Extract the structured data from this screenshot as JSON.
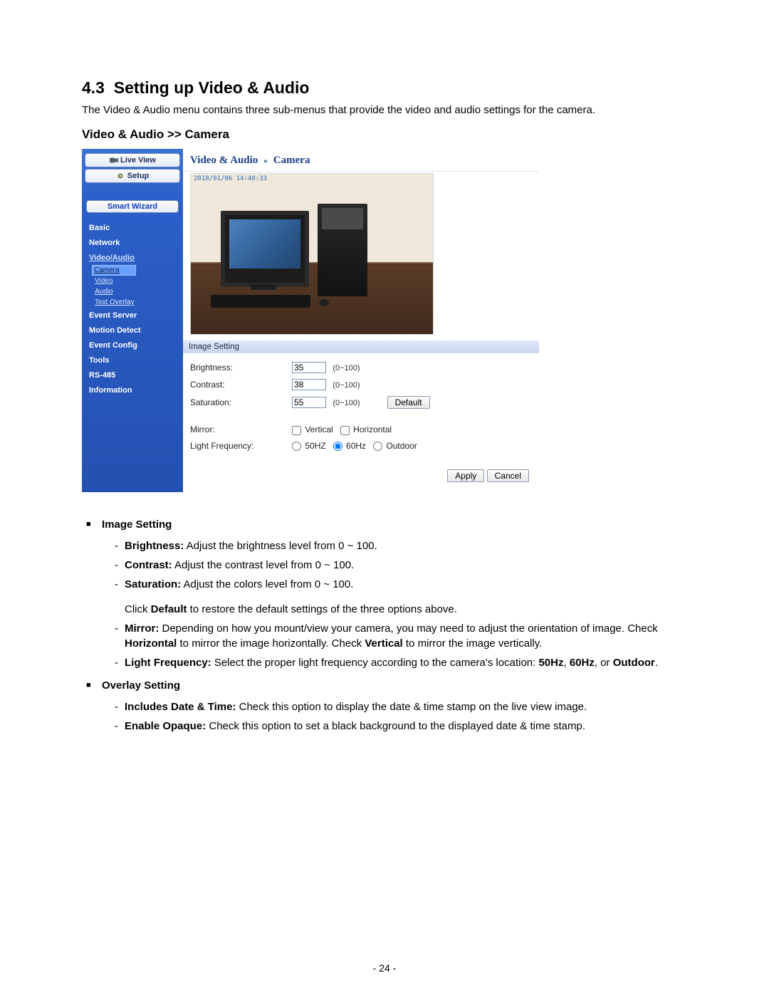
{
  "doc": {
    "section_number": "4.3",
    "section_title": "Setting up Video & Audio",
    "intro_text": "The Video & Audio menu contains three sub-menus that provide the video and audio settings for the camera.",
    "subhead": "Video & Audio >> Camera",
    "page_number": "- 24 -"
  },
  "ui": {
    "nav": {
      "live_view": "Live View",
      "setup": "Setup",
      "smart_wizard": "Smart Wizard",
      "links": {
        "basic": "Basic",
        "network": "Network",
        "video_audio": "Video/Audio",
        "camera": "Camera",
        "video": "Video",
        "audio": "Audio",
        "text_overlay": "Text Overlay",
        "event_server": "Event Server",
        "motion_detect": "Motion Detect",
        "event_config": "Event Config",
        "tools": "Tools",
        "rs485": "RS-485",
        "information": "Information"
      }
    },
    "breadcrumb": {
      "root": "Video & Audio",
      "separator": "»",
      "leaf": "Camera"
    },
    "preview": {
      "timestamp": "2018/01/06 14:40:33"
    },
    "panel_title": "Image Setting",
    "fields": {
      "brightness": {
        "label": "Brightness:",
        "value": "35",
        "range": "(0~100)"
      },
      "contrast": {
        "label": "Contrast:",
        "value": "38",
        "range": "(0~100)"
      },
      "saturation": {
        "label": "Saturation:",
        "value": "55",
        "range": "(0~100)"
      },
      "default_btn": "Default",
      "mirror": {
        "label": "Mirror:",
        "vertical": "Vertical",
        "horizontal": "Horizontal"
      },
      "light": {
        "label": "Light Frequency:",
        "opt50": "50HZ",
        "opt60": "60Hz",
        "optOut": "Outdoor"
      }
    },
    "actions": {
      "apply": "Apply",
      "cancel": "Cancel"
    }
  },
  "defs": {
    "image_setting": {
      "head": "Image Setting",
      "brightness": {
        "lead": "Brightness:",
        "body": " Adjust the brightness level from 0 ~ 100."
      },
      "contrast": {
        "lead": "Contrast:",
        "body": " Adjust the contrast level from 0 ~ 100."
      },
      "saturation": {
        "lead": "Saturation:",
        "body": " Adjust the colors level from 0 ~ 100."
      },
      "default_note_pre": "Click ",
      "default_note_bold": "Default",
      "default_note_post": " to restore the default settings of the three options above.",
      "mirror_lead": "Mirror:",
      "mirror_body1": " Depending on how you mount/view your camera, you may need to adjust the orientation of image. Check ",
      "mirror_b1": "Horizontal",
      "mirror_body2": " to mirror the image horizontally. Check ",
      "mirror_b2": "Vertical",
      "mirror_body3": " to mirror the image vertically.",
      "light_lead": "Light Frequency:",
      "light_body1": " Select the proper light frequency according to the camera's location: ",
      "light_b1": "50Hz",
      "light_sep1": ", ",
      "light_b2": "60Hz",
      "light_sep2": ", or ",
      "light_b3": "Outdoor",
      "light_end": "."
    },
    "overlay_setting": {
      "head": "Overlay Setting",
      "inc_dt_lead": "Includes Date & Time:",
      "inc_dt_body": " Check this option to display the date & time stamp on the live view image.",
      "opaque_lead": "Enable Opaque:",
      "opaque_body": " Check this option to set a black background to the displayed date & time stamp."
    }
  }
}
